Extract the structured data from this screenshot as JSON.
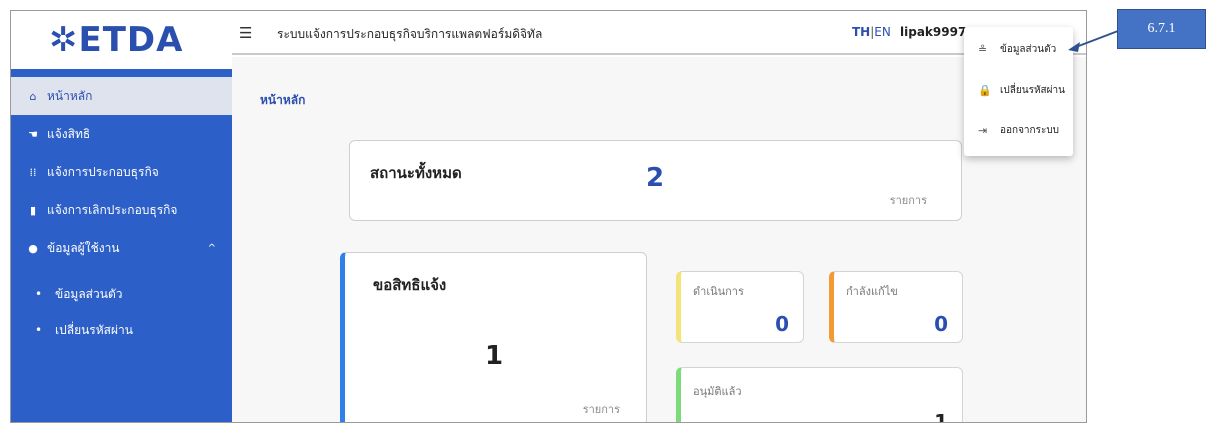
{
  "logo": {
    "text": "✲ETDA"
  },
  "topbar": {
    "title": "ระบบแจ้งการประกอบธุรกิจบริการแพลตฟอร์มดิจิทัล",
    "lang_th": "TH",
    "lang_sep": "|",
    "lang_en": "EN",
    "username": "lipak9997"
  },
  "sidebar": {
    "items": [
      {
        "label": "หน้าหลัก",
        "icon": "home-icon",
        "glyph": "⌂"
      },
      {
        "label": "แจ้งสิทธิ",
        "icon": "hand-icon",
        "glyph": "☚"
      },
      {
        "label": "แจ้งการประกอบธุรกิจ",
        "icon": "grid-icon",
        "glyph": "⁞⁞"
      },
      {
        "label": "แจ้งการเลิกประกอบธุรกิจ",
        "icon": "document-icon",
        "glyph": "▮"
      },
      {
        "label": "ข้อมูลผู้ใช้งาน",
        "icon": "user-icon",
        "glyph": "●"
      }
    ],
    "user_chevron": "^",
    "sub_items": [
      {
        "label": "ข้อมูลส่วนตัว"
      },
      {
        "label": "เปลี่ยนรหัสผ่าน"
      }
    ]
  },
  "main": {
    "breadcrumb": "หน้าหลัก",
    "all_status": {
      "title": "สถานะทั้งหมด",
      "count": "2",
      "unit": "รายการ"
    },
    "request": {
      "title": "ขอสิทธิแจ้ง",
      "count": "1",
      "unit": "รายการ"
    },
    "in_progress": {
      "title": "ดำเนินการ",
      "count": "0"
    },
    "editing": {
      "title": "กำลังแก้ไข",
      "count": "0"
    },
    "approved": {
      "title": "อนุมัติแล้ว",
      "count": "1"
    }
  },
  "dropdown": {
    "items": [
      {
        "label": "ข้อมูลส่วนตัว",
        "icon": "person-icon",
        "glyph": "≗"
      },
      {
        "label": "เปลี่ยนรหัสผ่าน",
        "icon": "lock-icon",
        "glyph": "🔒"
      },
      {
        "label": "ออกจากระบบ",
        "icon": "logout-icon",
        "glyph": "⇥"
      }
    ]
  },
  "callout": {
    "label": "6.7.1"
  },
  "colors": {
    "sidebar": "#2d5fc8",
    "accent": "#2b4fae",
    "request_bar": "#2f80ed",
    "progress_bar": "#f4e27a",
    "edit_bar": "#f29a33",
    "approved_bar": "#7ddb7a",
    "callout": "#4472c4"
  }
}
